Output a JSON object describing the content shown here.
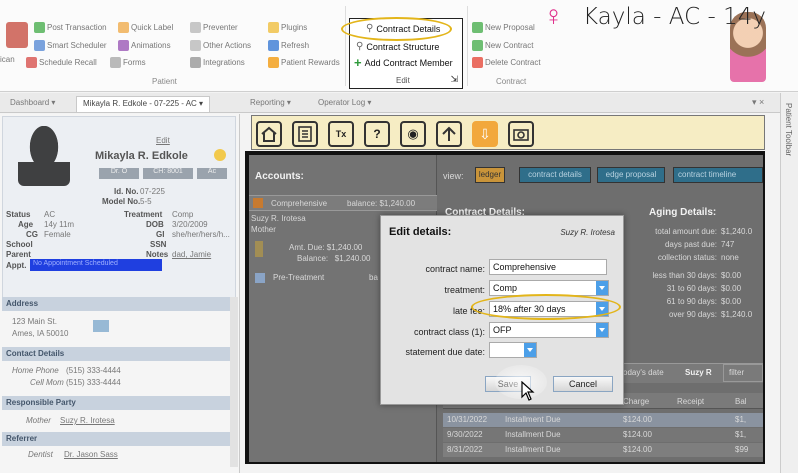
{
  "ribbon": {
    "patient_group": {
      "label": "Patient",
      "items": [
        "Post Transaction",
        "Quick Label",
        "Preventer",
        "Plugins",
        "Smart Scheduler",
        "Animations",
        "Other Actions",
        "Refresh",
        "Schedule Recall",
        "Forms",
        "Integrations",
        "Patient Rewards"
      ]
    },
    "contract_group": {
      "label": "Edit",
      "contract_details": "Contract Details",
      "contract_structure": "Contract Structure",
      "add_contract_member": "Add Contract Member"
    },
    "contract2_group": {
      "label": "Contract",
      "items": [
        "New Proposal",
        "New Contract",
        "Delete Contract"
      ]
    },
    "left_truncated": "ican"
  },
  "tabs": [
    "Dashboard",
    "Mikayla R. Edkole - 07-225 - AC",
    "Reporting",
    "Operator Log"
  ],
  "right_rail": "Patient Toolbar",
  "patient_card": {
    "edit": "Edit",
    "name": "Mikayla R. Edkole",
    "dr": "Dr. O",
    "ch": "CH: 8001",
    "status_badge": "Ac",
    "id_no_label": "Id. No.",
    "id_no": "07-225",
    "model_no_label": "Model No.",
    "model_no": "5-5",
    "status_label": "Status",
    "status": "AC",
    "treatment_label": "Treatment",
    "treatment": "Comp",
    "age_label": "Age",
    "age": "14y 11m",
    "dob_label": "DOB",
    "dob": "3/20/2009",
    "cg_label": "CG",
    "cg": "Female",
    "gi_label": "GI",
    "gi": "she/her/hers/h...",
    "school_label": "School",
    "ssn_label": "SSN",
    "parent_label": "Parent",
    "notes_label": "Notes",
    "notes": "dad, Jamie",
    "appt_label": "Appt.",
    "appt": "No Appointment Scheduled"
  },
  "address_section": {
    "header": "Address",
    "line1": "123 Main St.",
    "line2": "Ames, IA 50010"
  },
  "contact_section": {
    "header": "Contact Details",
    "home_label": "Home Phone",
    "home": "(515) 333-4444",
    "cell_label": "Cell Mom",
    "cell": "(515) 333-4444"
  },
  "responsible_section": {
    "header": "Responsible Party",
    "mother_label": "Mother",
    "mother": "Suzy R. Irotesa"
  },
  "referrer_section": {
    "header": "Referrer",
    "dentist_label": "Dentist",
    "dentist": "Dr. Jason Sass"
  },
  "banner": {
    "name": "Kayla - AC - 14y"
  },
  "ledger": {
    "accounts_title": "Accounts:",
    "account1": "Comprehensive",
    "account1_balance": "balance: $1,240.00",
    "account1_person": "Suzy R. Irotesa",
    "account1_relation": "Mother",
    "amt_due": "Amt. Due: $1,240.00",
    "balance_line": "Balance:   $1,240.00",
    "account2": "Pre-Treatment",
    "account2_balance": "ba",
    "view_label": "view:",
    "view_buttons": [
      "ledger",
      "contract details",
      "edge proposal",
      "contract timeline"
    ],
    "contract_details_title": "Contract Details:",
    "aging_title": "Aging Details:",
    "aging": [
      {
        "label": "total amount due:",
        "value": "$1,240.0"
      },
      {
        "label": "days past due:",
        "value": "747"
      },
      {
        "label": "collection status:",
        "value": "none"
      },
      {
        "label": "less than 30 days:",
        "value": "$0.00"
      },
      {
        "label": "31 to 60 days:",
        "value": "$0.00"
      },
      {
        "label": "61 to 90 days:",
        "value": "$0.00"
      },
      {
        "label": "over 90 days:",
        "value": "$1,240.0"
      }
    ],
    "filter_today": "oday's date",
    "filter_person": "Suzy R",
    "filter_tab": "filter",
    "col_charge": "Charge",
    "col_receipt": "Receipt",
    "col_bal": "Bal",
    "rows": [
      {
        "date": "10/31/2022",
        "desc": "Installment Due",
        "charge": "$124.00",
        "bal": "$1,"
      },
      {
        "date": "9/30/2022",
        "desc": "Installment Due",
        "charge": "$124.00",
        "bal": "$1,"
      },
      {
        "date": "8/31/2022",
        "desc": "Installment Due",
        "charge": "$124.00",
        "bal": "$99"
      }
    ]
  },
  "edit_dialog": {
    "title": "Edit details:",
    "person": "Suzy R. Irotesa",
    "contract_name_label": "contract name:",
    "contract_name": "Comprehensive",
    "treatment_label": "treatment:",
    "treatment": "Comp",
    "late_fee_label": "late fee:",
    "late_fee": "18% after 30 days",
    "contract_class_label": "contract class (1):",
    "contract_class": "OFP",
    "statement_due_label": "statement due date:",
    "statement_due": "",
    "save": "Save",
    "cancel": "Cancel"
  },
  "colors": {
    "highlight": "#e3b51a",
    "banner_bg": "#f6edc4",
    "accent_blue": "#4c9fe8",
    "female": "#e0308c",
    "orange": "#f2a83c"
  }
}
